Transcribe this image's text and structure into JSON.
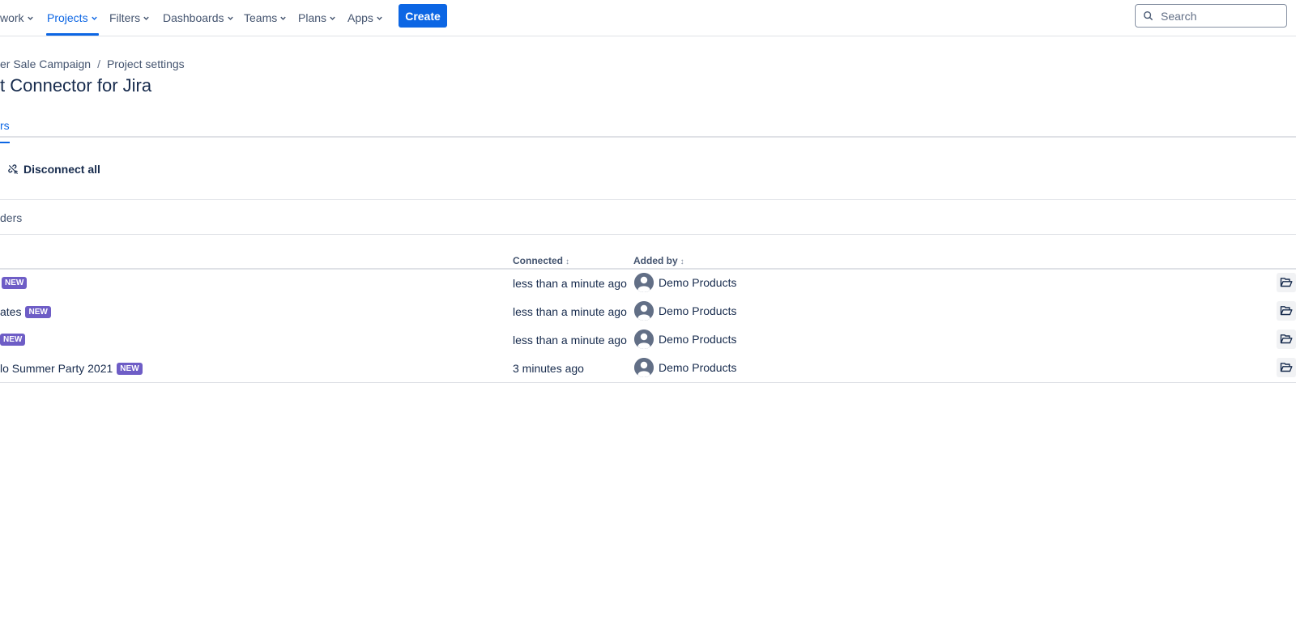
{
  "nav": {
    "items": [
      {
        "label": "work",
        "active": false
      },
      {
        "label": "Projects",
        "active": true
      },
      {
        "label": "Filters",
        "active": false
      },
      {
        "label": "Dashboards",
        "active": false
      },
      {
        "label": "Teams",
        "active": false
      },
      {
        "label": "Plans",
        "active": false
      },
      {
        "label": "Apps",
        "active": false
      }
    ],
    "create_label": "Create",
    "search_placeholder": "Search"
  },
  "breadcrumb": {
    "project": "er Sale Campaign",
    "settings": "Project settings",
    "separator": "/"
  },
  "page_title": "t Connector for Jira",
  "tab_label": "rs",
  "disconnect_all_label": "Disconnect all",
  "filter_label": "ders",
  "table": {
    "headers": {
      "connected": "Connected",
      "added_by": "Added by"
    },
    "sort_glyph": "↕",
    "rows": [
      {
        "name": "",
        "badge": "NEW",
        "connected": "less than a minute ago",
        "added_by": "Demo Products"
      },
      {
        "name": "ates",
        "badge": "NEW",
        "connected": "less than a minute ago",
        "added_by": "Demo Products"
      },
      {
        "name": "",
        "badge": "NEW",
        "connected": "less than a minute ago",
        "added_by": "Demo Products"
      },
      {
        "name": "lo Summer Party 2021",
        "badge": "NEW",
        "connected": "3 minutes ago",
        "added_by": "Demo Products"
      }
    ]
  },
  "colors": {
    "accent": "#0c66e4",
    "badge": "#6e5dc6",
    "text": "#172b4d",
    "subtle_text": "#44546f",
    "border": "#dfe1e6"
  },
  "icons": {
    "chevron": "chevron-down-icon",
    "search": "search-icon",
    "disconnect": "unlink-icon",
    "avatar": "user-avatar-icon",
    "open": "folder-open-icon"
  }
}
